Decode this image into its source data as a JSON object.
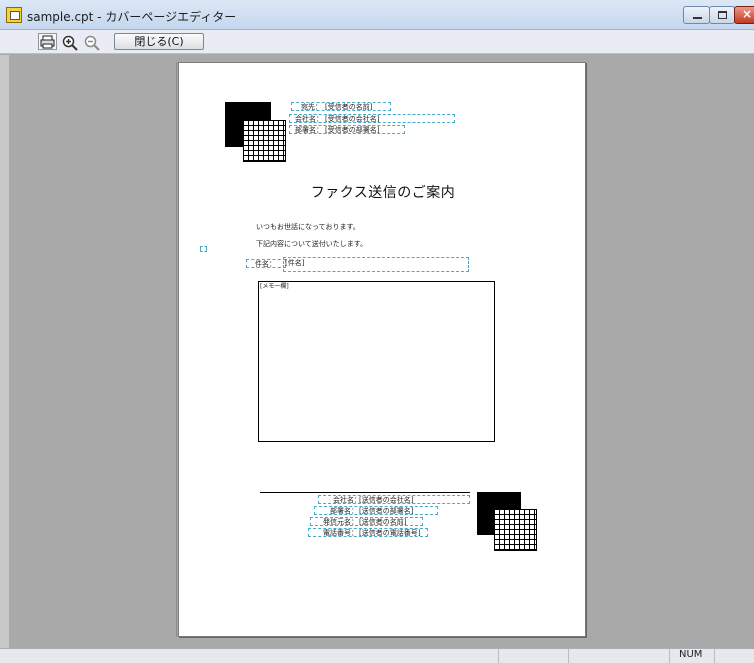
{
  "window": {
    "title": "sample.cpt - カバーページエディター"
  },
  "toolbar": {
    "print_icon": "printer-icon",
    "zoom_in_icon": "zoom-in-icon",
    "zoom_out_icon": "zoom-out-icon",
    "close_label": "閉じる(C)"
  },
  "header_fields": [
    {
      "label": "宛先：",
      "value": "[受信者の名前]"
    },
    {
      "label": "会社名：",
      "value": "[受信者の会社名]"
    },
    {
      "label": "部署名：",
      "value": "[受信者の部署名]"
    }
  ],
  "document": {
    "title": "ファクス送信のご案内",
    "greeting": "いつもお世話になっております。",
    "intro": "下記内容について送付いたします。",
    "subject_label": "件名：",
    "subject_value": "[件名]",
    "memo_label": "[メモ一欄]"
  },
  "footer_fields": [
    {
      "label": "会社名：",
      "value": "[送信者の会社名]"
    },
    {
      "label": "部署名：",
      "value": "[送信者の部署名]"
    },
    {
      "label": "発信元名：",
      "value": "[送信者の名前]"
    },
    {
      "label": "電話番号：",
      "value": "[送信者の電話番号]"
    }
  ],
  "statusbar": {
    "num": "NUM"
  },
  "colors": {
    "field_border": "#4aa9c6",
    "workspace": "#a9a9a9"
  }
}
